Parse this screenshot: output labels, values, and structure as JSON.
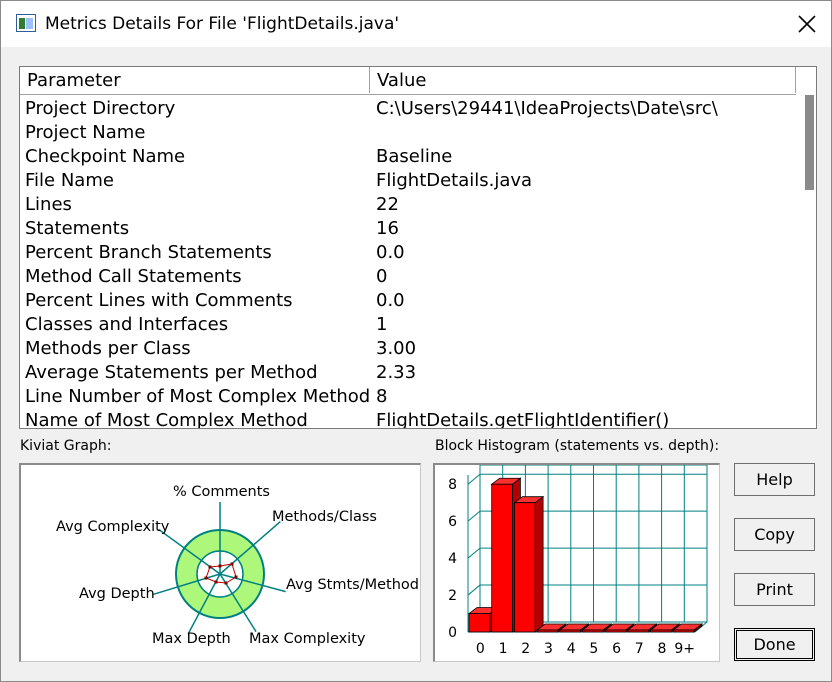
{
  "window": {
    "title": "Metrics Details For File 'FlightDetails.java'"
  },
  "table": {
    "headers": [
      "Parameter",
      "Value"
    ],
    "rows": [
      {
        "param": "Project Directory",
        "value": "C:\\Users\\29441\\IdeaProjects\\Date\\src\\"
      },
      {
        "param": "Project Name",
        "value": ""
      },
      {
        "param": "Checkpoint Name",
        "value": "Baseline"
      },
      {
        "param": "File Name",
        "value": "FlightDetails.java"
      },
      {
        "param": "Lines",
        "value": "22"
      },
      {
        "param": "Statements",
        "value": "16"
      },
      {
        "param": "Percent Branch Statements",
        "value": "0.0"
      },
      {
        "param": "Method Call Statements",
        "value": "0"
      },
      {
        "param": "Percent Lines with Comments",
        "value": "0.0"
      },
      {
        "param": "Classes and Interfaces",
        "value": "1"
      },
      {
        "param": "Methods per Class",
        "value": "3.00"
      },
      {
        "param": "Average Statements per Method",
        "value": "2.33"
      },
      {
        "param": "Line Number of Most Complex Method",
        "value": "8"
      },
      {
        "param": "Name of Most Complex Method",
        "value": "FlightDetails.getFlightIdentifier()"
      }
    ]
  },
  "kiviat": {
    "label": "Kiviat Graph:",
    "axes": [
      "% Comments",
      "Methods/Class",
      "Avg Stmts/Method",
      "Max Complexity",
      "Max Depth",
      "Avg Depth",
      "Avg Complexity"
    ]
  },
  "histogram": {
    "label": "Block Histogram (statements vs. depth):"
  },
  "buttons": {
    "help": "Help",
    "copy": "Copy",
    "print": "Print",
    "done": "Done"
  },
  "colors": {
    "bar": "#ff0000",
    "ring": "#adf77b",
    "grid": "#008080"
  },
  "chart_data": {
    "type": "bar",
    "title": "Block Histogram (statements vs. depth):",
    "categories": [
      "0",
      "1",
      "2",
      "3",
      "4",
      "5",
      "6",
      "7",
      "8",
      "9+"
    ],
    "values": [
      1,
      8,
      7,
      0,
      0,
      0,
      0,
      0,
      0,
      0
    ],
    "y_ticks": [
      "0",
      "2",
      "4",
      "6",
      "8"
    ],
    "ylim": [
      0,
      8.5
    ],
    "grid": true
  }
}
